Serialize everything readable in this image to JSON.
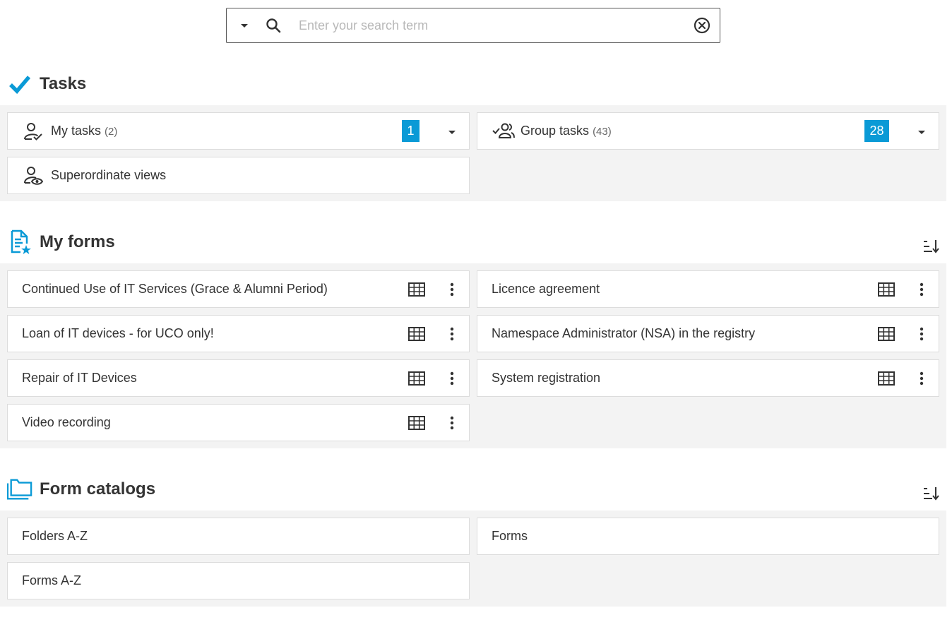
{
  "search": {
    "placeholder": "Enter your search term",
    "dropdown_icon": "caret-down-icon",
    "search_icon": "search-icon",
    "clear_icon": "clear-circle-icon"
  },
  "tasks": {
    "title": "Tasks",
    "icon": "checkmark-icon",
    "items": [
      {
        "label": "My tasks",
        "count": "(2)",
        "badge": "1",
        "icon": "person-check-icon"
      },
      {
        "label": "Group tasks",
        "count": "(43)",
        "badge": "28",
        "icon": "group-check-icon"
      },
      {
        "label": "Superordinate views",
        "icon": "person-eye-icon"
      }
    ]
  },
  "my_forms": {
    "title": "My forms",
    "icon": "form-star-icon",
    "sort_icon": "sort-icon",
    "items": [
      {
        "label": "Continued Use of IT Services (Grace & Alumni Period)"
      },
      {
        "label": "Licence agreement"
      },
      {
        "label": "Loan of IT devices - for UCO only!"
      },
      {
        "label": "Namespace Administrator (NSA) in the registry"
      },
      {
        "label": "Repair of IT Devices"
      },
      {
        "label": "System registration"
      },
      {
        "label": "Video recording"
      }
    ]
  },
  "form_catalogs": {
    "title": "Form catalogs",
    "icon": "folder-icon",
    "sort_icon": "sort-icon",
    "items": [
      {
        "label": "Folders A-Z"
      },
      {
        "label": "Forms"
      },
      {
        "label": "Forms A-Z"
      }
    ]
  },
  "colors": {
    "accent": "#0a9ad6",
    "panel_bg": "#f3f3f3",
    "text": "#333333"
  }
}
